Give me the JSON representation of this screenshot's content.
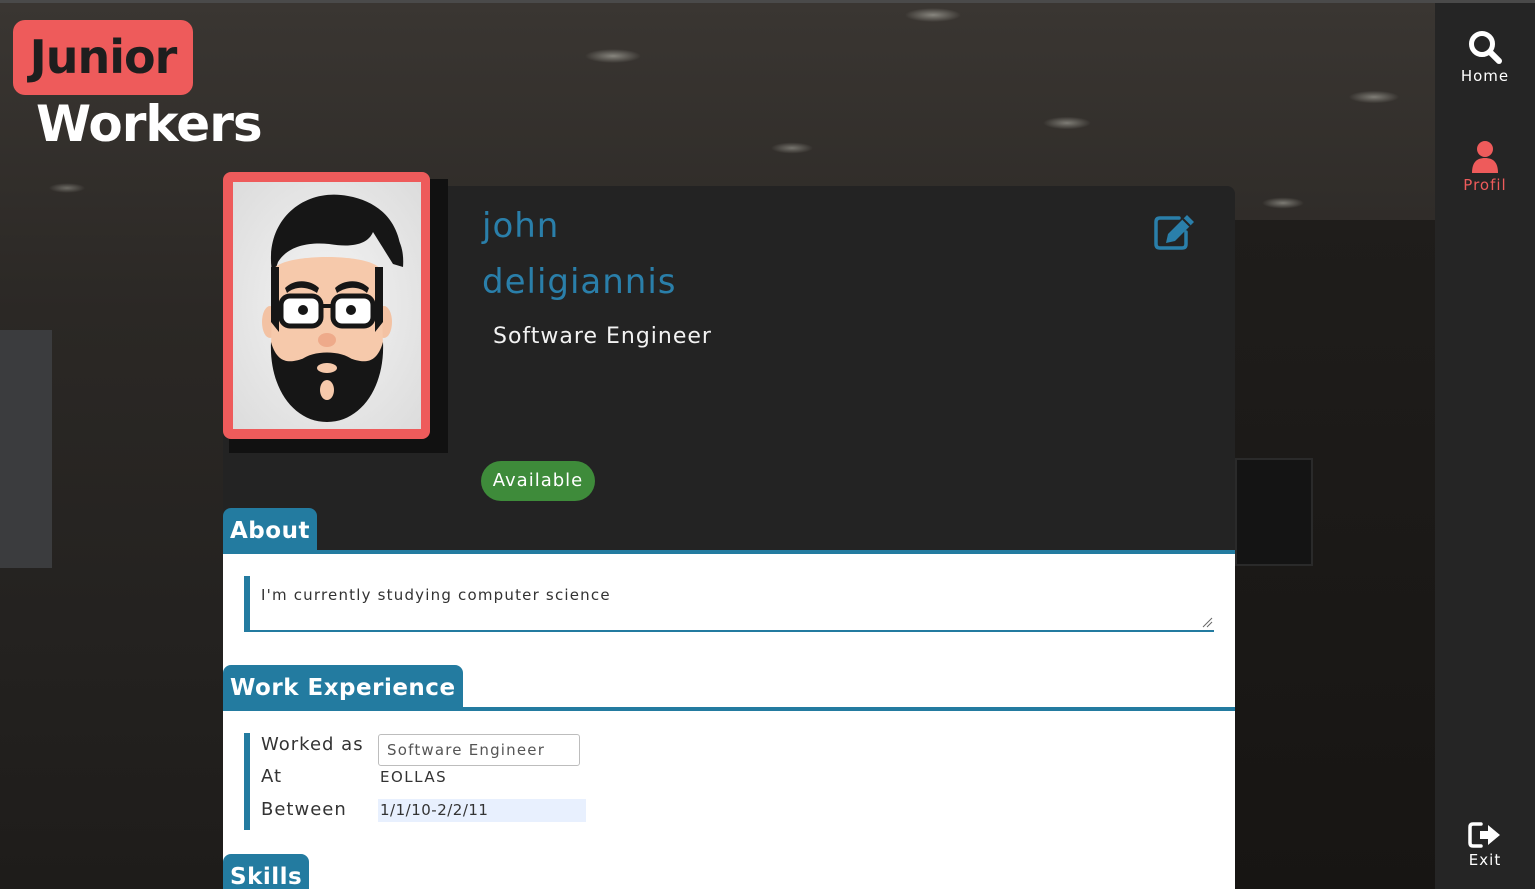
{
  "brand": {
    "line1": "Junior",
    "line2": "Workers"
  },
  "nav": {
    "home": "Home",
    "profile": "Profil",
    "exit": "Exit"
  },
  "profile": {
    "first_name": "john",
    "last_name": "deligiannis",
    "title": "Software Engineer",
    "status": "Available"
  },
  "sections": {
    "about_title": "About",
    "about_text": "I'm currently studying computer science",
    "work_title": "Work Experience",
    "skills_title": "Skills"
  },
  "work": {
    "worked_as_label": "Worked as",
    "worked_as_value": "Software Engineer",
    "at_label": "At",
    "at_value": "EOLLAS",
    "between_label": "Between",
    "between_value": "1/1/10-2/2/11"
  },
  "colors": {
    "accent_red": "#ee5b5b",
    "accent_blue": "#237ba0",
    "status_green": "#3e8b3a"
  }
}
